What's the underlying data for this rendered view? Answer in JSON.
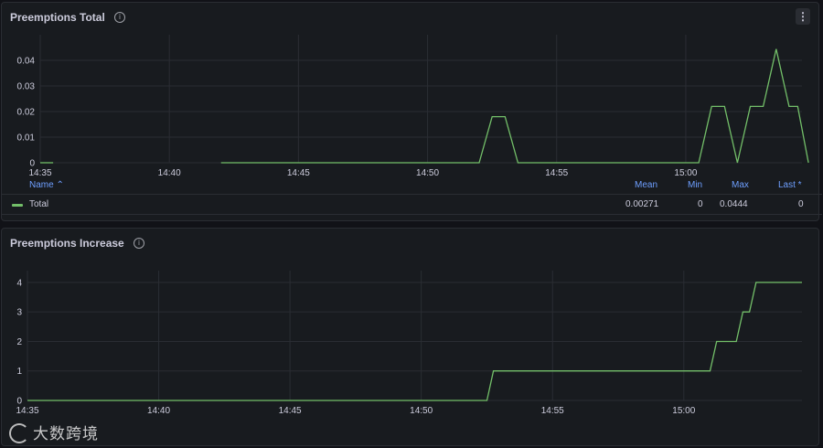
{
  "panel_total": {
    "title": "Preemptions Total",
    "legend": {
      "col_name": "Name ⌃",
      "col_mean": "Mean",
      "col_min": "Min",
      "col_max": "Max",
      "col_last": "Last *",
      "rows": [
        {
          "name": "Total",
          "mean": "0.00271",
          "min": "0",
          "max": "0.0444",
          "last": "0"
        }
      ]
    }
  },
  "panel_increase": {
    "title": "Preemptions Increase"
  },
  "watermark": {
    "text": "大数跨境"
  },
  "colors": {
    "series": "#73bf69",
    "grid": "#2a2d33",
    "legend_header": "#6e9fff"
  },
  "chart_data": [
    {
      "type": "line",
      "title": "Preemptions Total",
      "xlabel": "",
      "ylabel": "",
      "x_ticks": [
        "14:35",
        "14:40",
        "14:45",
        "14:50",
        "14:55",
        "15:00"
      ],
      "y_ticks": [
        "0",
        "0.01",
        "0.02",
        "0.03",
        "0.04"
      ],
      "ylim": [
        0,
        0.05
      ],
      "xlim": [
        "14:35",
        "15:04:30"
      ],
      "series": [
        {
          "name": "Total",
          "segments": [
            [
              [
                "14:35:00",
                0
              ],
              [
                "14:35:30",
                0
              ]
            ],
            [
              [
                "14:42:00",
                0
              ],
              [
                "14:52:00",
                0
              ],
              [
                "14:52:30",
                0.018
              ],
              [
                "14:53:00",
                0.018
              ],
              [
                "14:53:30",
                0
              ],
              [
                "15:00:30",
                0
              ],
              [
                "15:01:00",
                0.022
              ],
              [
                "15:01:30",
                0.022
              ],
              [
                "15:02:00",
                0
              ],
              [
                "15:02:30",
                0.022
              ],
              [
                "15:03:00",
                0.022
              ],
              [
                "15:03:30",
                0.0444
              ],
              [
                "15:04:00",
                0.022
              ],
              [
                "15:04:20",
                0.022
              ],
              [
                "15:04:45",
                0
              ]
            ]
          ]
        }
      ]
    },
    {
      "type": "line",
      "title": "Preemptions Increase",
      "xlabel": "",
      "ylabel": "",
      "x_ticks": [
        "14:35",
        "14:40",
        "14:45",
        "14:50",
        "14:55",
        "15:00"
      ],
      "y_ticks": [
        "0",
        "1",
        "2",
        "3",
        "4"
      ],
      "ylim": [
        0,
        4.4
      ],
      "xlim": [
        "14:35",
        "15:04:30"
      ],
      "series": [
        {
          "name": "Total",
          "segments": [
            [
              [
                "14:35:00",
                0
              ],
              [
                "14:52:30",
                0
              ],
              [
                "14:52:45",
                1
              ],
              [
                "15:01:00",
                1
              ],
              [
                "15:01:15",
                2
              ],
              [
                "15:02:00",
                2
              ],
              [
                "15:02:15",
                3
              ],
              [
                "15:02:30",
                3
              ],
              [
                "15:02:45",
                4
              ],
              [
                "15:04:30",
                4
              ]
            ]
          ]
        }
      ]
    }
  ]
}
